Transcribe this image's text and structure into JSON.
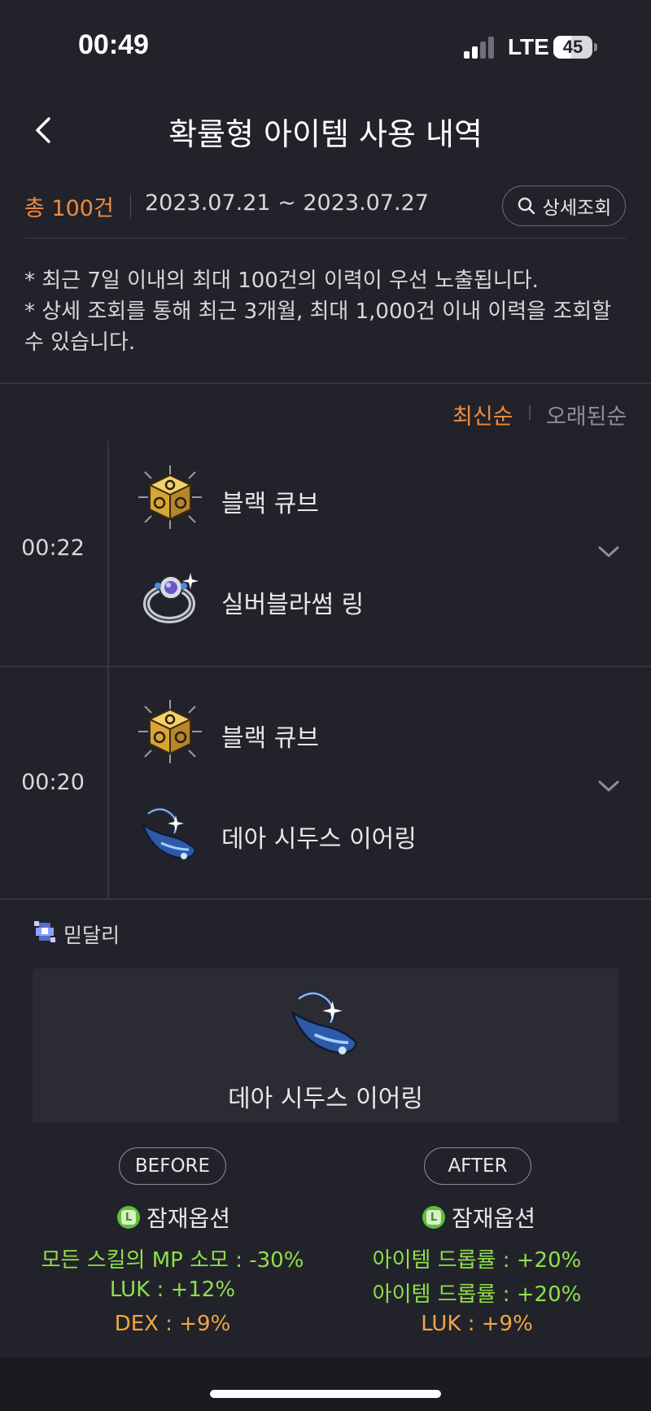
{
  "status": {
    "time": "00:49",
    "network": "LTE",
    "battery": "45"
  },
  "header": {
    "title": "확률형 아이템 사용 내역",
    "back_icon": "chevron-left-icon"
  },
  "summary": {
    "count": "총 100건",
    "date_range": "2023.07.21 ~ 2023.07.27",
    "detail_button": "상세조회"
  },
  "notice": [
    "* 최근 7일 이내의 최대 100건의 이력이 우선 노출됩니다.",
    "* 상세 조회를 통해 최근 3개월, 최대 1,000건 이내 이력을 조회할 수 있습니다."
  ],
  "sort": {
    "newest": "최신순",
    "oldest": "오래된순",
    "active": "newest"
  },
  "entries": [
    {
      "time": "00:22",
      "cube": "블랙 큐브",
      "item": "실버블라썸 링",
      "expanded": false
    },
    {
      "time": "00:20",
      "cube": "블랙 큐브",
      "item": "데아 시두스 이어링",
      "expanded": true
    }
  ],
  "detail": {
    "character": "믿달리",
    "item": "데아 시두스 이어링",
    "before": {
      "label": "BEFORE",
      "section": "잠재옵션",
      "options": [
        "모든 스킬의 MP 소모 : -30%",
        "LUK : +12%",
        "DEX : +9%"
      ]
    },
    "after": {
      "label": "AFTER",
      "section": "잠재옵션",
      "options": [
        "아이템 드롭률 : +20%",
        "아이템 드롭률 : +20%",
        "LUK : +9%"
      ]
    }
  },
  "colors": {
    "accent": "#f08a3e",
    "legendary_green": "#8fe04a",
    "unique_orange": "#f0a640",
    "background": "#22232a"
  }
}
